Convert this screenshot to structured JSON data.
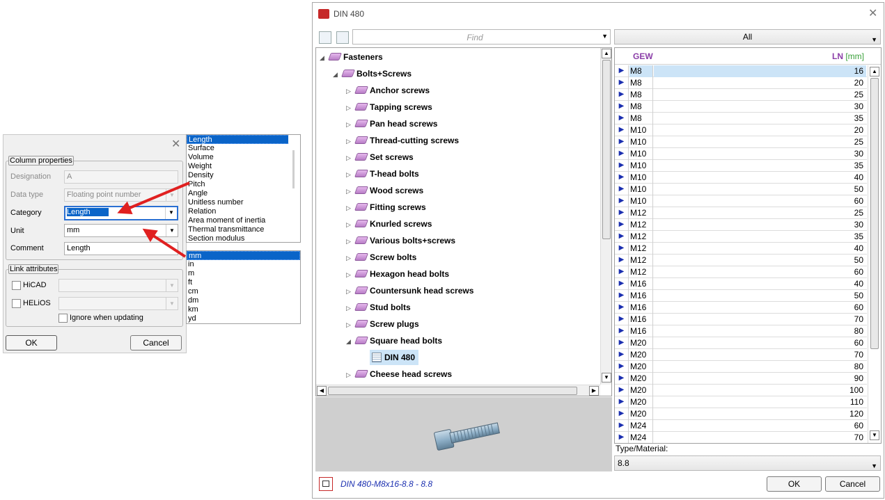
{
  "left_dialog": {
    "group_column": "Column properties",
    "designation_label": "Designation",
    "designation_value": "A",
    "datatype_label": "Data type",
    "datatype_value": "Floating point number",
    "category_label": "Category",
    "category_value": "Length",
    "unit_label": "Unit",
    "unit_value": "mm",
    "comment_label": "Comment",
    "comment_value": "Length",
    "group_link": "Link attributes",
    "hicad_label": "HiCAD",
    "helios_label": "HELiOS",
    "ignore_label": "Ignore when updating",
    "ok": "OK",
    "cancel": "Cancel"
  },
  "category_list": [
    "Length",
    "Surface",
    "Volume",
    "Weight",
    "Density",
    "Pitch",
    "Angle",
    "Unitless number",
    "Relation",
    "Area moment of inertia",
    "Thermal transmittance",
    "Section modulus"
  ],
  "unit_list": [
    "mm",
    "in",
    "m",
    "ft",
    "cm",
    "dm",
    "km",
    "yd"
  ],
  "main": {
    "title": "DIN 480",
    "find_placeholder": "Find",
    "filter_value": "All",
    "tree": {
      "root": "Fasteners",
      "group": "Bolts+Screws",
      "children": [
        "Anchor screws",
        "Tapping screws",
        "Pan head screws",
        "Thread-cutting screws",
        "Set screws",
        "T-head bolts",
        "Wood screws",
        "Fitting screws",
        "Knurled screws",
        "Various bolts+screws",
        "Screw bolts",
        "Hexagon head bolts",
        "Countersunk head screws",
        "Stud bolts",
        "Screw plugs",
        "Square head bolts"
      ],
      "selected_leaf": "DIN 480",
      "after": "Cheese head screws"
    },
    "table": {
      "col_gew": "GEW",
      "col_ln": "LN",
      "col_ln_unit": "[mm]",
      "rows": [
        [
          "M8",
          "16"
        ],
        [
          "M8",
          "20"
        ],
        [
          "M8",
          "25"
        ],
        [
          "M8",
          "30"
        ],
        [
          "M8",
          "35"
        ],
        [
          "M10",
          "20"
        ],
        [
          "M10",
          "25"
        ],
        [
          "M10",
          "30"
        ],
        [
          "M10",
          "35"
        ],
        [
          "M10",
          "40"
        ],
        [
          "M10",
          "50"
        ],
        [
          "M10",
          "60"
        ],
        [
          "M12",
          "25"
        ],
        [
          "M12",
          "30"
        ],
        [
          "M12",
          "35"
        ],
        [
          "M12",
          "40"
        ],
        [
          "M12",
          "50"
        ],
        [
          "M12",
          "60"
        ],
        [
          "M16",
          "40"
        ],
        [
          "M16",
          "50"
        ],
        [
          "M16",
          "60"
        ],
        [
          "M16",
          "70"
        ],
        [
          "M16",
          "80"
        ],
        [
          "M20",
          "60"
        ],
        [
          "M20",
          "70"
        ],
        [
          "M20",
          "80"
        ],
        [
          "M20",
          "90"
        ],
        [
          "M20",
          "100"
        ],
        [
          "M20",
          "110"
        ],
        [
          "M20",
          "120"
        ],
        [
          "M24",
          "60"
        ],
        [
          "M24",
          "70"
        ]
      ]
    },
    "type_material_label": "Type/Material:",
    "type_material_value": "8.8",
    "status_text": "DIN 480-M8x16-8.8 - 8.8",
    "ok": "OK",
    "cancel": "Cancel"
  },
  "colors": {
    "accent": "#0a64c8",
    "arrow": "#e02020",
    "header_purple": "#8b3ea8",
    "selection": "#cce4f7"
  }
}
